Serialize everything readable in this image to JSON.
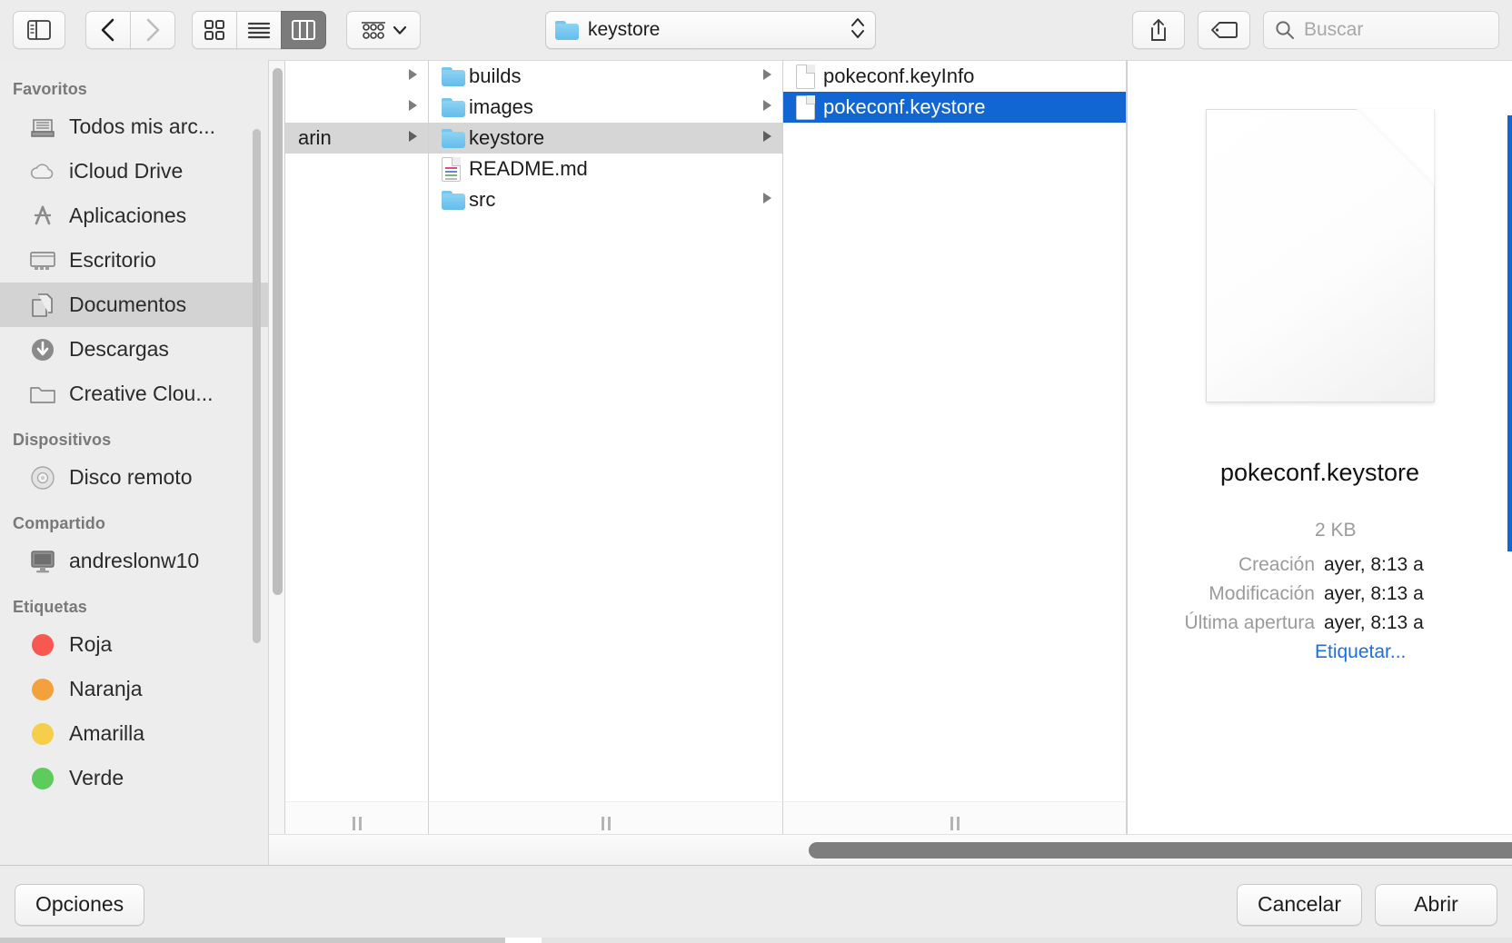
{
  "toolbar": {
    "sidebar_toggle": "sidebar-toggle",
    "back": "back",
    "forward": "forward",
    "view_icon": "icon-view",
    "view_list": "list-view",
    "view_column": "column-view",
    "arrange": "arrange",
    "path_label": "keystore",
    "share": "share",
    "tag": "tag",
    "search_placeholder": "Buscar"
  },
  "sidebar": {
    "sections": [
      {
        "header": "Favoritos",
        "items": [
          {
            "label": "Todos mis arc...",
            "icon": "all-my-files-icon",
            "selected": false
          },
          {
            "label": "iCloud Drive",
            "icon": "icloud-icon",
            "selected": false
          },
          {
            "label": "Aplicaciones",
            "icon": "applications-icon",
            "selected": false
          },
          {
            "label": "Escritorio",
            "icon": "desktop-icon",
            "selected": false
          },
          {
            "label": "Documentos",
            "icon": "documents-icon",
            "selected": true
          },
          {
            "label": "Descargas",
            "icon": "downloads-icon",
            "selected": false
          },
          {
            "label": "Creative Clou...",
            "icon": "folder-icon",
            "selected": false
          }
        ]
      },
      {
        "header": "Dispositivos",
        "items": [
          {
            "label": "Disco remoto",
            "icon": "remote-disc-icon",
            "selected": false
          }
        ]
      },
      {
        "header": "Compartido",
        "items": [
          {
            "label": "andreslonw10",
            "icon": "computer-icon",
            "selected": false
          }
        ]
      },
      {
        "header": "Etiquetas",
        "items": [
          {
            "label": "Roja",
            "icon": "tag-dot-icon",
            "color": "#f8584f",
            "selected": false
          },
          {
            "label": "Naranja",
            "icon": "tag-dot-icon",
            "color": "#f2a13c",
            "selected": false
          },
          {
            "label": "Amarilla",
            "icon": "tag-dot-icon",
            "color": "#f7cd4c",
            "selected": false
          },
          {
            "label": "Verde",
            "icon": "tag-dot-icon",
            "color": "#5ecc5c",
            "selected": false
          }
        ]
      }
    ]
  },
  "columns": [
    {
      "name": "column-1",
      "items": [
        {
          "label": "",
          "icon": "none",
          "has_children": true,
          "state": "none"
        },
        {
          "label": "",
          "icon": "none",
          "has_children": true,
          "state": "none"
        },
        {
          "label": "arin",
          "icon": "none",
          "has_children": true,
          "state": "selected-inactive"
        },
        {
          "label": "",
          "icon": "none",
          "has_children": false,
          "state": "none"
        }
      ]
    },
    {
      "name": "column-2",
      "items": [
        {
          "label": "builds",
          "icon": "folder-icon",
          "has_children": true,
          "state": "none"
        },
        {
          "label": "images",
          "icon": "folder-icon",
          "has_children": true,
          "state": "none"
        },
        {
          "label": "keystore",
          "icon": "folder-icon",
          "has_children": true,
          "state": "selected-inactive"
        },
        {
          "label": "README.md",
          "icon": "markdown-doc-icon",
          "has_children": false,
          "state": "none"
        },
        {
          "label": "src",
          "icon": "folder-icon",
          "has_children": true,
          "state": "none"
        }
      ]
    },
    {
      "name": "column-3",
      "items": [
        {
          "label": "pokeconf.keyInfo",
          "icon": "generic-doc-icon",
          "has_children": false,
          "state": "none"
        },
        {
          "label": "pokeconf.keystore",
          "icon": "generic-doc-icon",
          "has_children": false,
          "state": "selected-active"
        }
      ]
    }
  ],
  "preview": {
    "file_name": "pokeconf.keystore",
    "size": "2 KB",
    "fields": [
      {
        "key": "Creación",
        "value": "ayer, 8:13 a"
      },
      {
        "key": "Modificación",
        "value": "ayer, 8:13 a"
      },
      {
        "key": "Última apertura",
        "value": "ayer, 8:13 a"
      }
    ],
    "tag_link": "Etiquetar..."
  },
  "footer": {
    "options_label": "Opciones",
    "cancel_label": "Cancelar",
    "open_label": "Abrir"
  },
  "colors": {
    "accent": "#1266d4",
    "selection_inactive": "#d6d6d6",
    "window_chrome": "#ececec"
  }
}
